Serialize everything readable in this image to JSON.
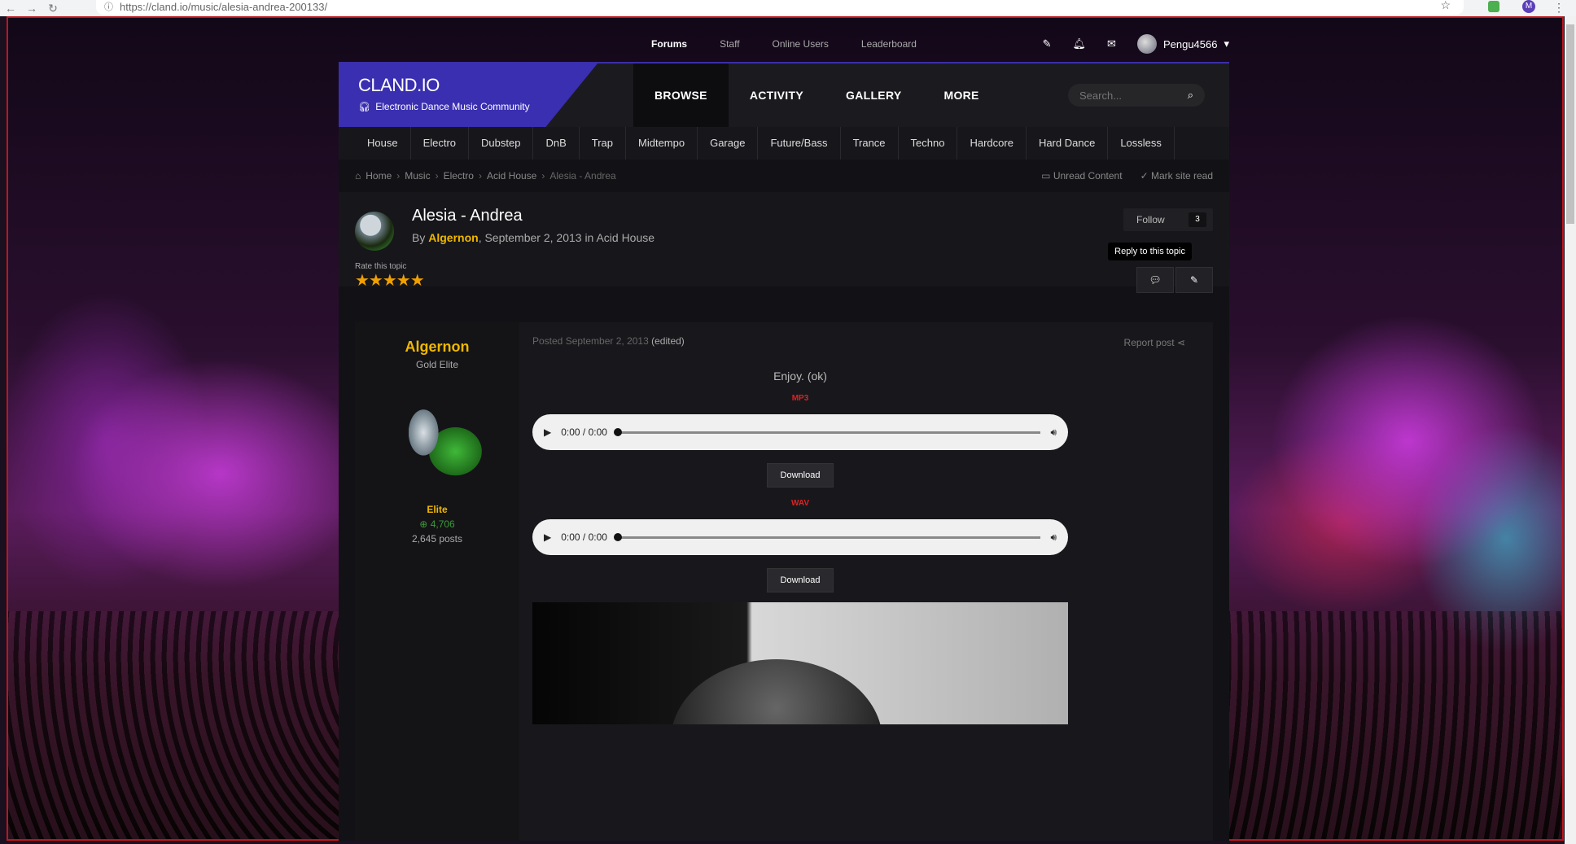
{
  "browser": {
    "url": "https://cland.io/music/alesia-andrea-200133/",
    "back_icon": "arrow-left-icon",
    "forward_icon": "arrow-right-icon",
    "reload_icon": "reload-icon",
    "profile_initial": "M"
  },
  "userbar": {
    "links": [
      "Forums",
      "Staff",
      "Online Users",
      "Leaderboard"
    ],
    "username": "Pengu4566",
    "caret": "▾"
  },
  "brand": {
    "name": "CLAND.IO",
    "tagline": "Electronic Dance Music Community",
    "accent": "#3a2fb0"
  },
  "mainnav": [
    "BROWSE",
    "ACTIVITY",
    "GALLERY",
    "MORE"
  ],
  "search": {
    "placeholder": "Search..."
  },
  "genres": [
    "House",
    "Electro",
    "Dubstep",
    "DnB",
    "Trap",
    "Midtempo",
    "Garage",
    "Future/Bass",
    "Trance",
    "Techno",
    "Hardcore",
    "Hard Dance",
    "Lossless"
  ],
  "breadcrumb": {
    "home": "Home",
    "items": [
      "Music",
      "Electro",
      "Acid House"
    ],
    "current": "Alesia - Andrea",
    "unread": "Unread Content",
    "mark_read": "Mark site read"
  },
  "topic": {
    "title": "Alesia - Andrea",
    "by": "By",
    "author": "Algernon",
    "date_in": ", September 2, 2013 in Acid House",
    "rate_label": "Rate this topic",
    "stars": "★★★★★",
    "follow_label": "Follow",
    "follow_count": "3",
    "tooltip": "Reply to this topic"
  },
  "post": {
    "author": "Algernon",
    "rank": "Gold Elite",
    "role": "Elite",
    "reputation": "4,706",
    "posts": "2,645 posts",
    "posted": "Posted September 2, 2013",
    "edited": "(edited)",
    "report": "Report post",
    "lead": "Enjoy. (ok)",
    "formats": [
      {
        "label": "MP3",
        "time": "0:00 / 0:00",
        "download": "Download"
      },
      {
        "label": "WAV",
        "time": "0:00 / 0:00",
        "download": "Download"
      }
    ]
  }
}
